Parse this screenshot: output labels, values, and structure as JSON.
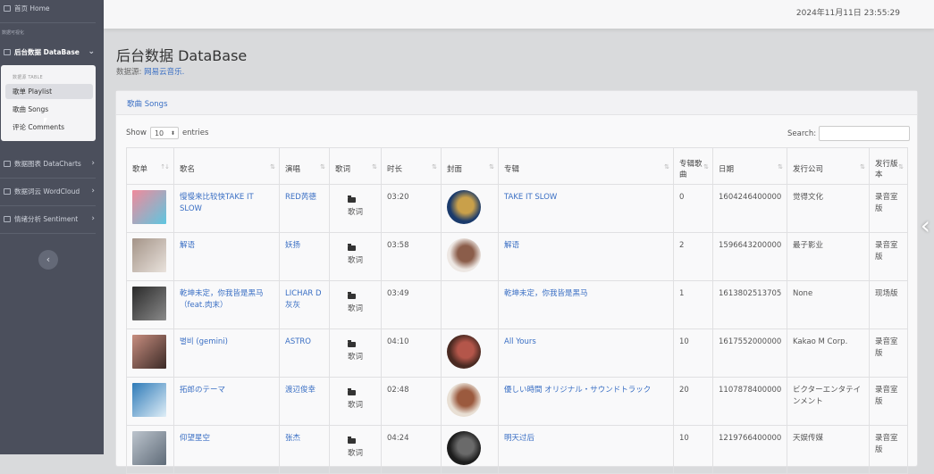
{
  "sidebar": {
    "home": "首页 Home",
    "section_label": "数据可视化",
    "database": "后台数据 DataBase",
    "submenu_header": "数据源 TABLE",
    "submenu": [
      "歌单 Playlist",
      "歌曲 Songs",
      "评论 Comments"
    ],
    "charts": "数据图表 DataCharts",
    "wordcloud": "数据词云 WordCloud",
    "sentiment": "情绪分析 Sentiment",
    "collapse_icon": "‹"
  },
  "topbar": {
    "datetime": "2024年11月11日 23:55:29"
  },
  "page": {
    "title": "后台数据 DataBase",
    "source_label": "数据源:",
    "source_value": "网易云音乐."
  },
  "card": {
    "title": "歌曲 Songs"
  },
  "controls": {
    "show": "Show",
    "page_size": "10",
    "entries": "entries",
    "search": "Search:"
  },
  "table": {
    "headers": [
      "歌单",
      "歌名",
      "演唱",
      "歌词",
      "时长",
      "封面",
      "专辑",
      "专辑歌曲",
      "日期",
      "发行公司",
      "发行版本"
    ],
    "rows": [
      {
        "name": "慢慢来比较快TAKE IT SLOW",
        "artist": "RED芮德",
        "lyric": "歌词",
        "duration": "03:20",
        "album": "TAKE IT SLOW",
        "count": "0",
        "date": "1604246400000",
        "company": "觉得文化",
        "version": "录音室版",
        "thumb": [
          "#f08a9b",
          "#5ec6e0"
        ],
        "cover": [
          "#1a3a6b",
          "#c9a04a"
        ]
      },
      {
        "name": "解语",
        "artist": "妖扬",
        "lyric": "歌词",
        "duration": "03:58",
        "album": "解语",
        "count": "2",
        "date": "1596643200000",
        "company": "最子影业",
        "version": "录音室版",
        "thumb": [
          "#a49488",
          "#e9e2dc"
        ],
        "cover": [
          "#ede7e3",
          "#8b5d4a"
        ]
      },
      {
        "name": "乾坤未定，你我皆是黑马（feat.肉末）",
        "artist": "LICHAR D 灰灰",
        "lyric": "歌词",
        "duration": "03:49",
        "album": "乾坤未定，你我皆是黑马",
        "count": "1",
        "date": "1613802513705",
        "company": "None",
        "version": "现场版",
        "thumb": [
          "#2a2a2a",
          "#8a8a8a"
        ],
        "cover": null
      },
      {
        "name": "별비 (gemini)",
        "artist": "ASTRO",
        "lyric": "歌词",
        "duration": "04:10",
        "album": "All Yours",
        "count": "10",
        "date": "1617552000000",
        "company": "Kakao M Corp.",
        "version": "录音室版",
        "thumb": [
          "#c78d7f",
          "#3b2a26"
        ],
        "cover": [
          "#4a2a22",
          "#b4564a"
        ]
      },
      {
        "name": "拓郎のテーマ",
        "artist": "渡辺俊幸",
        "lyric": "歌词",
        "duration": "02:48",
        "album": "優しい時間 オリジナル・サウンドトラック",
        "count": "20",
        "date": "1107878400000",
        "company": "ビクターエンタテインメント",
        "version": "录音室版",
        "thumb": [
          "#2f7bb8",
          "#dfeef7"
        ],
        "cover": [
          "#e8dfd4",
          "#9b5a3e"
        ]
      },
      {
        "name": "仰望星空",
        "artist": "张杰",
        "lyric": "歌词",
        "duration": "04:24",
        "album": "明天过后",
        "count": "10",
        "date": "1219766400000",
        "company": "天娱传媒",
        "version": "录音室版",
        "thumb": [
          "#bcc4cd",
          "#5f6b78"
        ],
        "cover": [
          "#1c1c1c",
          "#6a6a6a"
        ]
      }
    ]
  },
  "icons": {
    "home": "home-icon",
    "database": "table-icon",
    "charts": "chart-icon",
    "wordcloud": "cloud-icon",
    "sentiment": "sentiment-icon",
    "lyric": "folder-icon"
  }
}
